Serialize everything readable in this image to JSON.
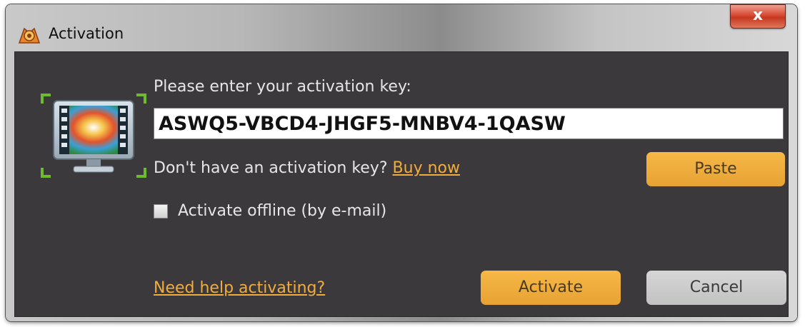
{
  "window": {
    "title": "Activation",
    "close_label": "x"
  },
  "dialog": {
    "key_label": "Please enter your activation key:",
    "key_value": "ASWQ5-VBCD4-JHGF5-MNBV4-1QASW",
    "no_key_text": "Don't have an activation key?",
    "buy_now_link": "Buy now",
    "paste_button": "Paste",
    "offline_label": "Activate offline (by e-mail)",
    "offline_checked": false,
    "help_link": "Need help activating?",
    "activate_button": "Activate",
    "cancel_button": "Cancel"
  },
  "icons": {
    "app": "movavi-app-icon",
    "monitor": "monitor-video-icon"
  },
  "colors": {
    "accent": "#f2ac3c",
    "dialog_bg": "#3c393d",
    "close_red": "#c53820"
  }
}
